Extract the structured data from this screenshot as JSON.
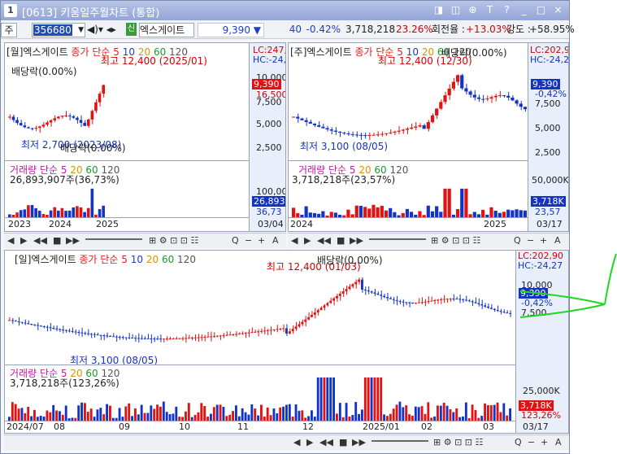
{
  "titlebar": {
    "num": "1",
    "title": "[0613] 키움일주월차트 (통합)",
    "buttons": [
      "◨",
      "◫",
      "⊕",
      "T",
      "?",
      "_",
      "□",
      "×"
    ]
  },
  "toolbar": {
    "type": "주",
    "code": "356680",
    "stock_name": "엑스게이트",
    "sin": "신",
    "price": "9,390 ▼",
    "diff": "40",
    "rate": "-0.42%",
    "volume": "3,718,218",
    "vol_rate": "23.26%",
    "turnover_label": "회전율 :",
    "turnover": "+13.03%",
    "strength_label": "강도 :",
    "strength": "+58.95%"
  },
  "monthly": {
    "title": "[월]엑스게이트",
    "ma_label": "종가 단순",
    "ma": [
      "5",
      "10",
      "20",
      "60",
      "120"
    ],
    "high_note": "최고 12,400 (2025/01)",
    "low_note": "최저 2,700 (2023/08)",
    "dividend1": "배당락(0.00%)",
    "dividend2": "배당락(0.00%)",
    "lc": "LC:247,7",
    "hc": "HC:-24,2",
    "y_ticks": [
      "10,000",
      "7,500",
      "5,000",
      "2,500"
    ],
    "price_box": "9,390",
    "price_box2": "16,500",
    "vol_title": "거래량",
    "vol_ma": "단순 5",
    "vol_ma_vals": [
      "20",
      "60",
      "120"
    ],
    "vol_value": "26,893,907주(36,73%)",
    "vol_ticks": [
      "100,000"
    ],
    "vol_box": "26,893",
    "vol_box2": "36,73",
    "x_labels": [
      "2023",
      "2024",
      "2025"
    ],
    "date": "03/04"
  },
  "weekly": {
    "title": "[주]엑스게이트",
    "ma_label": "종가 단순 5",
    "ma": [
      "10",
      "20",
      "60",
      "120"
    ],
    "high_note": "최고 12,400 (12/30)",
    "low_note": "최저 3,100 (08/05)",
    "dividend": "배당락(0.00%)",
    "lc": "LC:202,9",
    "hc": "HC:-24,2",
    "y_ticks": [
      "7,500",
      "5,000",
      "2,500"
    ],
    "price_box": "9,390",
    "rate_box": "-0,42%",
    "vol_title": "거래량",
    "vol_ma": "단순 5",
    "vol_ma_vals": [
      "20",
      "60",
      "120"
    ],
    "vol_value": "3,718,218주(23,57%)",
    "vol_ticks": [
      "50,000K"
    ],
    "vol_box": "3,718K",
    "vol_box2": "23,57",
    "x_labels": [
      "2024",
      "2025"
    ],
    "date": "03/17"
  },
  "daily": {
    "title": "[일]엑스게이트",
    "ma_label": "종가 단순",
    "ma": [
      "5",
      "10",
      "20",
      "60",
      "120"
    ],
    "high_note": "최고 12,400 (01/03)",
    "low_note": "최저 3,100 (08/05)",
    "dividend": "배당락(0.00%)",
    "lc": "LC:202,90",
    "hc": "HC:-24,27",
    "y_ticks": [
      "10,000",
      "7,500"
    ],
    "price_box": "9,390",
    "rate_box": "-0,42%",
    "vol_title": "거래량",
    "vol_ma": "단순 5",
    "vol_ma_vals": [
      "20",
      "60",
      "120"
    ],
    "vol_value": "3,718,218주(123,26%)",
    "vol_ticks": [
      "25,000K"
    ],
    "vol_box": "3,718K",
    "vol_box2": "123,26%",
    "x_labels": [
      "2024/07",
      "08",
      "09",
      "10",
      "11",
      "12",
      "2025/01",
      "02",
      "03"
    ],
    "date": "03/17"
  },
  "nav_buttons": [
    "◀",
    "▶",
    "◀◀",
    "■",
    "▶▶"
  ],
  "tool_icons": [
    "Q",
    "−",
    "+",
    "A"
  ]
}
